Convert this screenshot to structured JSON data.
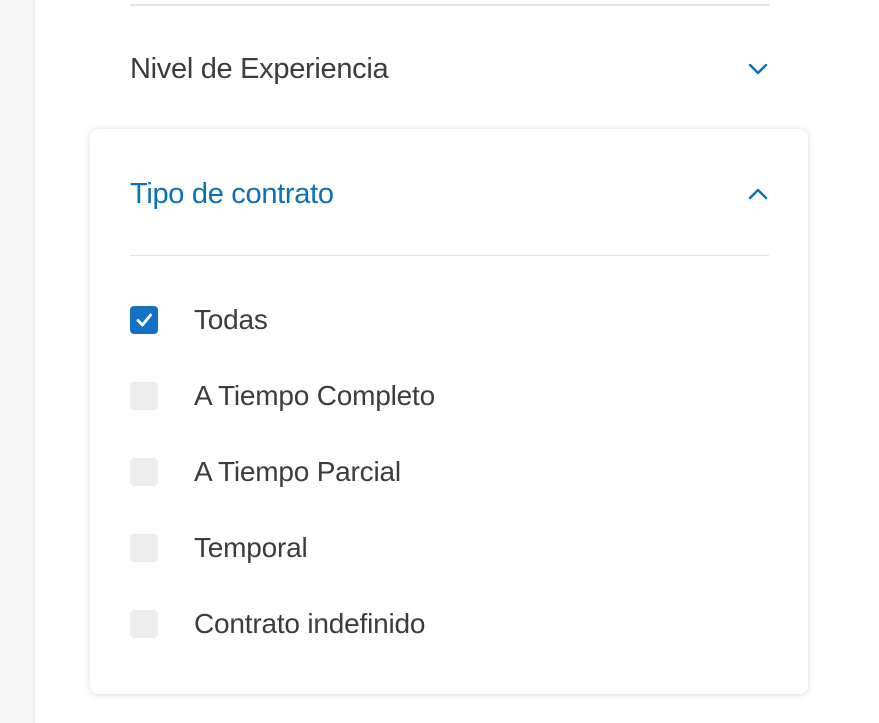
{
  "filters": {
    "experience": {
      "title": "Nivel de Experiencia",
      "expanded": false,
      "icon": "chevron-down-icon"
    },
    "contract": {
      "title": "Tipo de contrato",
      "expanded": true,
      "icon": "chevron-up-icon",
      "options": [
        {
          "label": "Todas",
          "checked": true
        },
        {
          "label": "A Tiempo Completo",
          "checked": false
        },
        {
          "label": "A Tiempo Parcial",
          "checked": false
        },
        {
          "label": "Temporal",
          "checked": false
        },
        {
          "label": "Contrato indefinido",
          "checked": false
        }
      ]
    }
  },
  "colors": {
    "accent": "#0a71b6",
    "checkbox_checked": "#1570c8",
    "checkbox_unchecked": "#ececec",
    "text": "#3c3c3c"
  }
}
